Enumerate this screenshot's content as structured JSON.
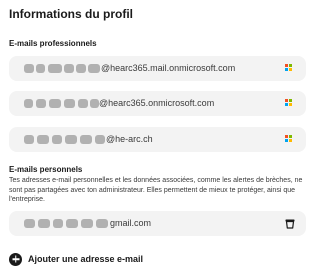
{
  "page": {
    "title": "Informations du profil"
  },
  "professional": {
    "label": "E-mails professionnels",
    "emails": [
      {
        "visible": "@hearc365.mail.onmicrosoft.com",
        "icon": "microsoft-icon"
      },
      {
        "visible": "@hearc365.onmicrosoft.com",
        "icon": "microsoft-icon"
      },
      {
        "visible": "@he-arc.ch",
        "icon": "microsoft-icon"
      }
    ]
  },
  "personal": {
    "label": "E-mails personnels",
    "description": "Tes adresses e-mail personnelles et les données associées, comme les alertes de brèches, ne sont pas partagées avec ton administrateur. Elles permettent de mieux te protéger, ainsi que l'entreprise.",
    "emails": [
      {
        "visible": "gmail.com",
        "icon": "trash-icon"
      }
    ]
  },
  "add_email": {
    "label": "Ajouter une adresse e-mail",
    "icon": "plus-circle-icon"
  },
  "colors": {
    "row_bg": "#f3f3f3",
    "text": "#1a1a1a",
    "ms_red": "#f25022",
    "ms_green": "#7fba00",
    "ms_blue": "#00a4ef",
    "ms_yellow": "#ffb900"
  }
}
